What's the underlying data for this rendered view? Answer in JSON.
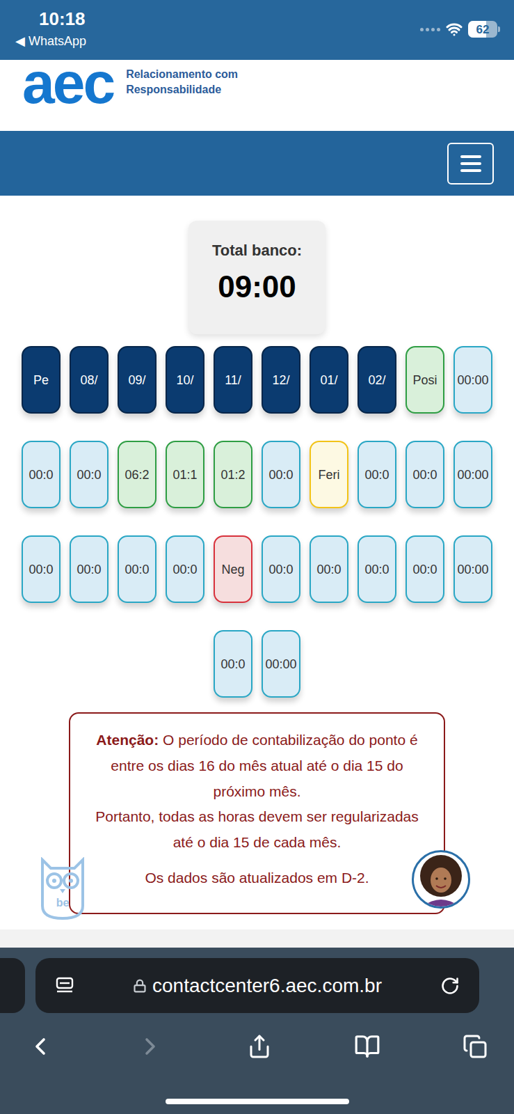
{
  "status_bar": {
    "time": "10:18",
    "back_app": "◀ WhatsApp",
    "battery": "62",
    "battery_level": 0.62
  },
  "header": {
    "logo": "aec",
    "tagline": [
      "Relacionamento com",
      "Responsabilidade"
    ]
  },
  "summary": {
    "label": "Total banco:",
    "value": "09:00"
  },
  "days": [
    {
      "text": "Pe",
      "kind": "header",
      "color": "#06264a"
    },
    {
      "text": "08/",
      "kind": "header",
      "color": "#06264a"
    },
    {
      "text": "09/",
      "kind": "header",
      "color": "#06264a"
    },
    {
      "text": "10/",
      "kind": "header",
      "color": "#06264a"
    },
    {
      "text": "11/",
      "kind": "header",
      "color": "#06264a"
    },
    {
      "text": "12/",
      "kind": "header",
      "color": "#06264a"
    },
    {
      "text": "01/",
      "kind": "header",
      "color": "#06264a"
    },
    {
      "text": "02/",
      "kind": "header",
      "color": "#06264a"
    },
    {
      "text": "Posi",
      "kind": "positive",
      "color": "#2f9e44"
    },
    {
      "text": "00:00",
      "kind": "zero",
      "color": "#2aa7c5"
    },
    {
      "text": "00:0",
      "kind": "zero",
      "color": "#2aa7c5"
    },
    {
      "text": "00:0",
      "kind": "zero",
      "color": "#2aa7c5"
    },
    {
      "text": "06:2",
      "kind": "positive",
      "color": "#2f9e44"
    },
    {
      "text": "01:1",
      "kind": "positive",
      "color": "#2f9e44"
    },
    {
      "text": "01:2",
      "kind": "positive",
      "color": "#2f9e44"
    },
    {
      "text": "00:0",
      "kind": "zero",
      "color": "#2aa7c5"
    },
    {
      "text": "Feri",
      "kind": "holiday",
      "color": "#f2c318"
    },
    {
      "text": "00:0",
      "kind": "zero",
      "color": "#2aa7c5"
    },
    {
      "text": "00:0",
      "kind": "zero",
      "color": "#2aa7c5"
    },
    {
      "text": "00:00",
      "kind": "zero",
      "color": "#2aa7c5"
    },
    {
      "text": "00:0",
      "kind": "zero",
      "color": "#2aa7c5"
    },
    {
      "text": "00:0",
      "kind": "zero",
      "color": "#2aa7c5"
    },
    {
      "text": "00:0",
      "kind": "zero",
      "color": "#2aa7c5"
    },
    {
      "text": "00:0",
      "kind": "zero",
      "color": "#2aa7c5"
    },
    {
      "text": "Neg",
      "kind": "negative",
      "color": "#d8323c"
    },
    {
      "text": "00:0",
      "kind": "zero",
      "color": "#2aa7c5"
    },
    {
      "text": "00:0",
      "kind": "zero",
      "color": "#2aa7c5"
    },
    {
      "text": "00:0",
      "kind": "zero",
      "color": "#2aa7c5"
    },
    {
      "text": "00:0",
      "kind": "zero",
      "color": "#2aa7c5"
    },
    {
      "text": "00:00",
      "kind": "zero",
      "color": "#2aa7c5"
    },
    {
      "text": "00:0",
      "kind": "zero",
      "color": "#2aa7c5"
    },
    {
      "text": "00:00",
      "kind": "zero",
      "color": "#2aa7c5"
    }
  ],
  "notice": {
    "title": "Atenção:",
    "text": "O período de contabilização do ponto é entre os dias 16 do mês atual até o dia 15 do próximo mês.",
    "line2": "Portanto, todas as horas devem ser regularizadas até o dia 15 de cada mês.",
    "note": "Os dados são atualizados em D-2."
  },
  "assistant": {
    "owl_label": "be"
  },
  "browser": {
    "url": "contactcenter6.aec.com.br",
    "forward_disabled": true
  }
}
